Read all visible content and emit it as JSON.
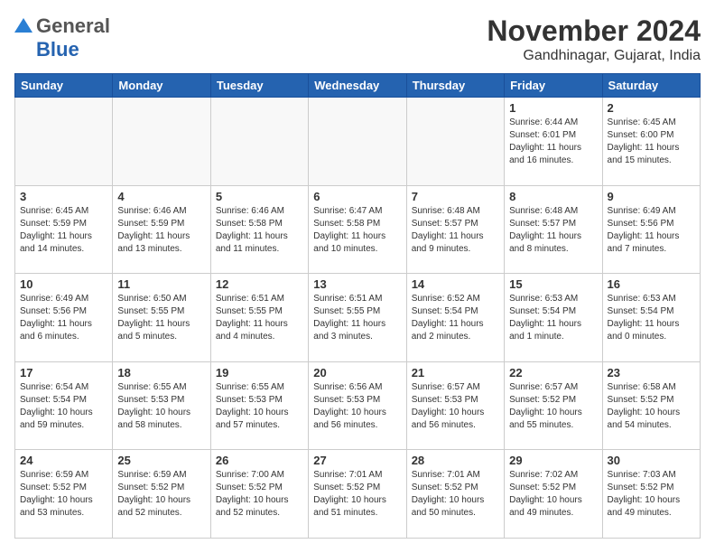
{
  "header": {
    "logo_general": "General",
    "logo_blue": "Blue",
    "month_title": "November 2024",
    "location": "Gandhinagar, Gujarat, India"
  },
  "weekdays": [
    "Sunday",
    "Monday",
    "Tuesday",
    "Wednesday",
    "Thursday",
    "Friday",
    "Saturday"
  ],
  "weeks": [
    [
      {
        "day": "",
        "text": ""
      },
      {
        "day": "",
        "text": ""
      },
      {
        "day": "",
        "text": ""
      },
      {
        "day": "",
        "text": ""
      },
      {
        "day": "",
        "text": ""
      },
      {
        "day": "1",
        "text": "Sunrise: 6:44 AM\nSunset: 6:01 PM\nDaylight: 11 hours\nand 16 minutes."
      },
      {
        "day": "2",
        "text": "Sunrise: 6:45 AM\nSunset: 6:00 PM\nDaylight: 11 hours\nand 15 minutes."
      }
    ],
    [
      {
        "day": "3",
        "text": "Sunrise: 6:45 AM\nSunset: 5:59 PM\nDaylight: 11 hours\nand 14 minutes."
      },
      {
        "day": "4",
        "text": "Sunrise: 6:46 AM\nSunset: 5:59 PM\nDaylight: 11 hours\nand 13 minutes."
      },
      {
        "day": "5",
        "text": "Sunrise: 6:46 AM\nSunset: 5:58 PM\nDaylight: 11 hours\nand 11 minutes."
      },
      {
        "day": "6",
        "text": "Sunrise: 6:47 AM\nSunset: 5:58 PM\nDaylight: 11 hours\nand 10 minutes."
      },
      {
        "day": "7",
        "text": "Sunrise: 6:48 AM\nSunset: 5:57 PM\nDaylight: 11 hours\nand 9 minutes."
      },
      {
        "day": "8",
        "text": "Sunrise: 6:48 AM\nSunset: 5:57 PM\nDaylight: 11 hours\nand 8 minutes."
      },
      {
        "day": "9",
        "text": "Sunrise: 6:49 AM\nSunset: 5:56 PM\nDaylight: 11 hours\nand 7 minutes."
      }
    ],
    [
      {
        "day": "10",
        "text": "Sunrise: 6:49 AM\nSunset: 5:56 PM\nDaylight: 11 hours\nand 6 minutes."
      },
      {
        "day": "11",
        "text": "Sunrise: 6:50 AM\nSunset: 5:55 PM\nDaylight: 11 hours\nand 5 minutes."
      },
      {
        "day": "12",
        "text": "Sunrise: 6:51 AM\nSunset: 5:55 PM\nDaylight: 11 hours\nand 4 minutes."
      },
      {
        "day": "13",
        "text": "Sunrise: 6:51 AM\nSunset: 5:55 PM\nDaylight: 11 hours\nand 3 minutes."
      },
      {
        "day": "14",
        "text": "Sunrise: 6:52 AM\nSunset: 5:54 PM\nDaylight: 11 hours\nand 2 minutes."
      },
      {
        "day": "15",
        "text": "Sunrise: 6:53 AM\nSunset: 5:54 PM\nDaylight: 11 hours\nand 1 minute."
      },
      {
        "day": "16",
        "text": "Sunrise: 6:53 AM\nSunset: 5:54 PM\nDaylight: 11 hours\nand 0 minutes."
      }
    ],
    [
      {
        "day": "17",
        "text": "Sunrise: 6:54 AM\nSunset: 5:54 PM\nDaylight: 10 hours\nand 59 minutes."
      },
      {
        "day": "18",
        "text": "Sunrise: 6:55 AM\nSunset: 5:53 PM\nDaylight: 10 hours\nand 58 minutes."
      },
      {
        "day": "19",
        "text": "Sunrise: 6:55 AM\nSunset: 5:53 PM\nDaylight: 10 hours\nand 57 minutes."
      },
      {
        "day": "20",
        "text": "Sunrise: 6:56 AM\nSunset: 5:53 PM\nDaylight: 10 hours\nand 56 minutes."
      },
      {
        "day": "21",
        "text": "Sunrise: 6:57 AM\nSunset: 5:53 PM\nDaylight: 10 hours\nand 56 minutes."
      },
      {
        "day": "22",
        "text": "Sunrise: 6:57 AM\nSunset: 5:52 PM\nDaylight: 10 hours\nand 55 minutes."
      },
      {
        "day": "23",
        "text": "Sunrise: 6:58 AM\nSunset: 5:52 PM\nDaylight: 10 hours\nand 54 minutes."
      }
    ],
    [
      {
        "day": "24",
        "text": "Sunrise: 6:59 AM\nSunset: 5:52 PM\nDaylight: 10 hours\nand 53 minutes."
      },
      {
        "day": "25",
        "text": "Sunrise: 6:59 AM\nSunset: 5:52 PM\nDaylight: 10 hours\nand 52 minutes."
      },
      {
        "day": "26",
        "text": "Sunrise: 7:00 AM\nSunset: 5:52 PM\nDaylight: 10 hours\nand 52 minutes."
      },
      {
        "day": "27",
        "text": "Sunrise: 7:01 AM\nSunset: 5:52 PM\nDaylight: 10 hours\nand 51 minutes."
      },
      {
        "day": "28",
        "text": "Sunrise: 7:01 AM\nSunset: 5:52 PM\nDaylight: 10 hours\nand 50 minutes."
      },
      {
        "day": "29",
        "text": "Sunrise: 7:02 AM\nSunset: 5:52 PM\nDaylight: 10 hours\nand 49 minutes."
      },
      {
        "day": "30",
        "text": "Sunrise: 7:03 AM\nSunset: 5:52 PM\nDaylight: 10 hours\nand 49 minutes."
      }
    ]
  ]
}
